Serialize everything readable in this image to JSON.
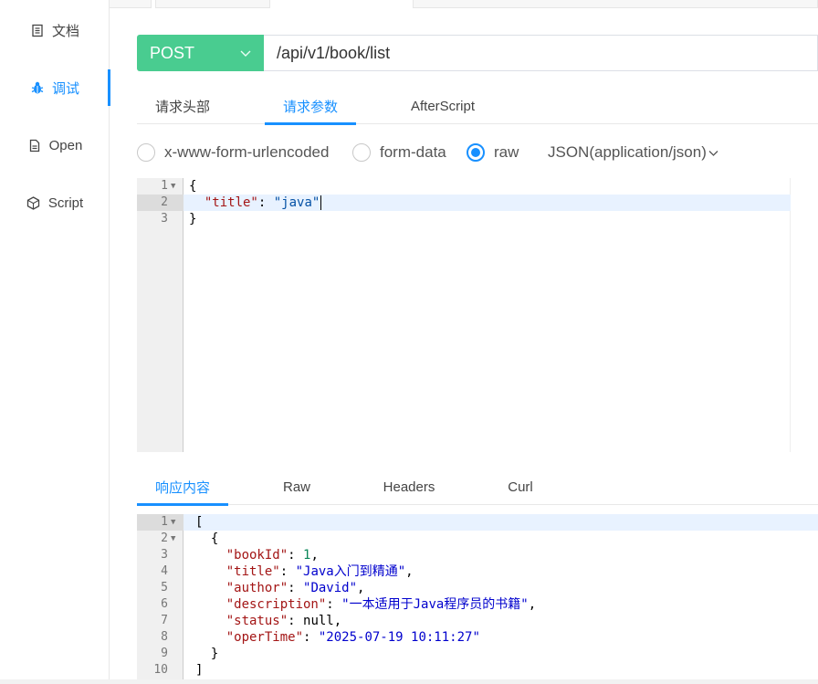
{
  "sidebar": {
    "items": [
      {
        "label": "文档",
        "icon": "document-icon"
      },
      {
        "label": "调试",
        "icon": "bug-icon"
      },
      {
        "label": "Open",
        "icon": "file-icon"
      },
      {
        "label": "Script",
        "icon": "codesandbox-icon"
      }
    ]
  },
  "request": {
    "method": "POST",
    "url": "/api/v1/book/list"
  },
  "request_tabs": [
    "请求头部",
    "请求参数",
    "AfterScript"
  ],
  "body_types": [
    "x-www-form-urlencoded",
    "form-data",
    "raw"
  ],
  "content_type": "JSON(application/json)",
  "request_body": {
    "lines": [
      {
        "num": "1",
        "code": "{"
      },
      {
        "num": "2",
        "key": "\"title\"",
        "sep": ": ",
        "val": "\"java\""
      },
      {
        "num": "3",
        "code": "}"
      }
    ]
  },
  "response_tabs": [
    "响应内容",
    "Raw",
    "Headers",
    "Curl"
  ],
  "response_body": {
    "lines": [
      {
        "num": "1",
        "code": "["
      },
      {
        "num": "2",
        "code": "  {"
      },
      {
        "num": "3",
        "key": "\"bookId\"",
        "sep": ": ",
        "val": "1",
        "tail": ","
      },
      {
        "num": "4",
        "key": "\"title\"",
        "sep": ": ",
        "val": "\"Java入门到精通\"",
        "tail": ","
      },
      {
        "num": "5",
        "key": "\"author\"",
        "sep": ": ",
        "val": "\"David\"",
        "tail": ","
      },
      {
        "num": "6",
        "key": "\"description\"",
        "sep": ": ",
        "val": "\"一本适用于Java程序员的书籍\"",
        "tail": ","
      },
      {
        "num": "7",
        "key": "\"status\"",
        "sep": ": ",
        "val": "null",
        "tail": ","
      },
      {
        "num": "8",
        "key": "\"operTime\"",
        "sep": ": ",
        "val": "\"2025-07-19 10:11:27\""
      },
      {
        "num": "9",
        "code": "  }"
      },
      {
        "num": "10",
        "code": "]"
      }
    ]
  },
  "colors": {
    "accent": "#1890ff",
    "post": "#49cc90"
  }
}
